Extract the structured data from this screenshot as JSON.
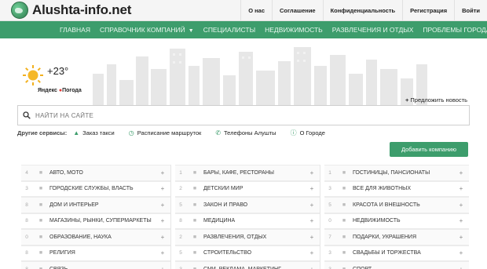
{
  "header": {
    "logo_text": "Alushta-info.net",
    "nav": [
      "О нас",
      "Соглашение",
      "Конфиденциальность",
      "Регистрация",
      "Войти"
    ]
  },
  "menu": {
    "items": [
      "ГЛАВНАЯ",
      "СПРАВОЧНИК КОМПАНИЙ",
      "СПЕЦИАЛИСТЫ",
      "НЕДВИЖИМОСТЬ",
      "РАЗВЛЕЧЕНИЯ И ОТДЫХ",
      "ПРОБЛЕМЫ ГОРОДА"
    ]
  },
  "weather": {
    "temperature": "+23°",
    "provider_prefix": "Яндекс",
    "provider_suffix": "Погода"
  },
  "suggest_news": "Предложить новость",
  "search": {
    "placeholder": "НАЙТИ НА САЙТЕ"
  },
  "services": {
    "label": "Другие сервисы:",
    "items": [
      "Заказ такси",
      "Расписание маршруток",
      "Телефоны Алушты",
      "О Городе"
    ]
  },
  "add_company": "Добавить компанию",
  "catalog": {
    "col1": [
      {
        "num": "4",
        "label": "АВТО, МОТО"
      },
      {
        "num": "3",
        "label": "ГОРОДСКИЕ СЛУЖБЫ, ВЛАСТЬ"
      },
      {
        "num": "8",
        "label": "ДОМ И ИНТЕРЬЕР"
      },
      {
        "num": "8",
        "label": "МАГАЗИНЫ, РЫНКИ, СУПЕРМАРКЕТЫ"
      },
      {
        "num": "0",
        "label": "ОБРАЗОВАНИЕ, НАУКА"
      },
      {
        "num": "8",
        "label": "РЕЛИГИЯ"
      },
      {
        "num": "8",
        "label": "СВЯЗЬ"
      }
    ],
    "col2": [
      {
        "num": "1",
        "label": "БАРЫ, КАФЕ, РЕСТОРАНЫ"
      },
      {
        "num": "2",
        "label": "ДЕТСКИЙ МИР"
      },
      {
        "num": "5",
        "label": "ЗАКОН И ПРАВО"
      },
      {
        "num": "8",
        "label": "МЕДИЦИНА"
      },
      {
        "num": "2",
        "label": "РАЗВЛЕЧЕНИЯ, ОТДЫХ"
      },
      {
        "num": "5",
        "label": "СТРОИТЕЛЬСТВО"
      },
      {
        "num": "3",
        "label": "СМИ, РЕКЛАМА, МАРКЕТИНГ"
      }
    ],
    "col3": [
      {
        "num": "1",
        "label": "ГОСТИНИЦЫ, ПАНСИОНАТЫ"
      },
      {
        "num": "3",
        "label": "ВСЕ ДЛЯ ЖИВОТНЫХ"
      },
      {
        "num": "5",
        "label": "КРАСОТА И ВНЕШНОСТЬ"
      },
      {
        "num": "0",
        "label": "НЕДВИЖИМОСТЬ"
      },
      {
        "num": "7",
        "label": "ПОДАРКИ, УКРАШЕНИЯ"
      },
      {
        "num": "3",
        "label": "СВАДЬБЫ И ТОРЖЕСТВА"
      },
      {
        "num": "3",
        "label": "СПОРТ"
      }
    ]
  },
  "colors": {
    "brand_green": "#3d9d6c",
    "topbar_bg": "#f5f5f5"
  }
}
